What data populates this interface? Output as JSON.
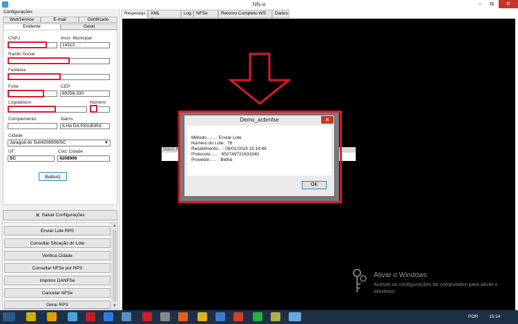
{
  "window": {
    "title": "Nfs-e",
    "minimize": "–",
    "restore": "⧉",
    "close": "✕"
  },
  "config": {
    "section_label": "Configurações",
    "tabs_top": [
      "WebService",
      "E-mail",
      "Certificado"
    ],
    "tabs_bottom": [
      "Emitente",
      "Geral"
    ]
  },
  "emitente": {
    "cnpj_label": "CNPJ",
    "insc_label": "Inscr. Municipal",
    "insc_value": "14313",
    "razao_label": "Razão Social",
    "fantasia_label": "Fantasia",
    "fone_label": "Fone",
    "cep_label": "CEP",
    "cep_value": "89258-330",
    "logradouro_label": "Logradouro",
    "numero_label": "Número",
    "complemento_label": "Complemento",
    "bairro_label": "Bairro",
    "bairro_value": "ILHA DA FIGUEIRA",
    "cidade_label": "Cidade",
    "cidade_value": "Jaraguá do Sul/4208906/SC",
    "uf_label": "UF",
    "uf_value": "SC",
    "cod_cidade_label": "Cód. Cidade",
    "cod_cidade_value": "4208906",
    "button1": "Button1"
  },
  "save_button": "Salvar Configurações",
  "actions": [
    "Enviar Lote RPS",
    "Consultar Situação do Lote",
    "Verifica Cidade",
    "Consultar NFSe por RPS",
    "Imprimir DANFSe",
    "Cancelar NFSe",
    "Gerar RPS"
  ],
  "right_tabs": [
    "Respostas",
    "XML Resposta",
    "Log",
    "NFSe",
    "Retorno Completo WS",
    "Dados"
  ],
  "status_strip_label": "Status R",
  "dialog": {
    "title": "Demo_acbrnfse",
    "lines": [
      "Método........: Enviar Lote",
      "Numero do Lote : 76",
      "Recebimento... : 08/01/2019 15:14:48",
      "Protocolo...... : 652749721633340",
      "Provedor...... : Betha"
    ],
    "ok": "OK"
  },
  "watermark": {
    "title": "Ativar o Windows",
    "text": "Acesse as configurações do computador para ativar o Windows."
  },
  "taskbar": {
    "lang": "POR",
    "time": "15:14"
  },
  "colors": {
    "redaction": "#e0182c",
    "taskbar": "#1e3047",
    "accent": "#3a9fd8"
  }
}
